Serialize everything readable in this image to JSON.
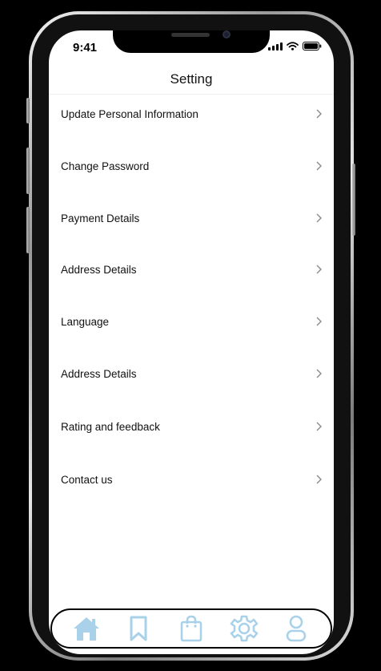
{
  "status_bar": {
    "time": "9:41"
  },
  "header": {
    "title": "Setting"
  },
  "menu": {
    "items": [
      {
        "label": "Update Personal Information"
      },
      {
        "label": "Change Password"
      },
      {
        "label": "Payment Details"
      },
      {
        "label": "Address Details"
      },
      {
        "label": "Language"
      },
      {
        "label": "Address Details"
      },
      {
        "label": "Rating and feedback"
      },
      {
        "label": "Contact us"
      }
    ]
  },
  "tab_bar": {
    "icons": [
      "home-icon",
      "bookmark-icon",
      "shopping-bag-icon",
      "gear-icon",
      "user-icon"
    ],
    "icon_color": "#a9d2ea"
  },
  "colors": {
    "background": "#000000",
    "screen": "#ffffff",
    "text": "#111111",
    "chevron": "#8a8a8a"
  }
}
